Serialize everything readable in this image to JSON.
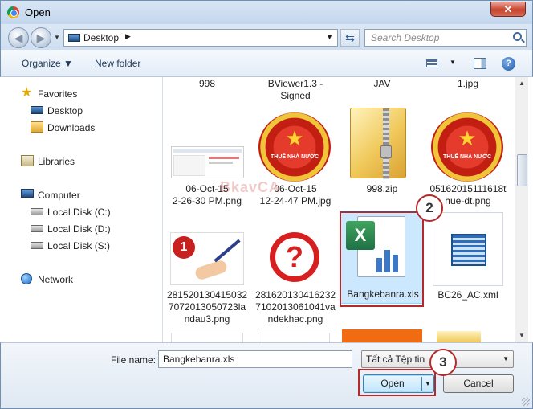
{
  "window": {
    "title": "Open",
    "close_symbol": "✕"
  },
  "nav": {
    "back_symbol": "◀",
    "forward_symbol": "▶",
    "dropdown_symbol": "▼",
    "breadcrumb": "Desktop",
    "crumb_sep": "▶",
    "refresh_symbol": "⇆",
    "search_placeholder": "Search Desktop"
  },
  "toolbar": {
    "organize": "Organize ▼",
    "new_folder": "New folder",
    "view_dd": "▼",
    "help": "?"
  },
  "sidebar": {
    "favorites": "Favorites",
    "desktop": "Desktop",
    "downloads": "Downloads",
    "libraries": "Libraries",
    "computer": "Computer",
    "disk_c": "Local Disk (C:)",
    "disk_d": "Local Disk (D:)",
    "disk_s": "Local Disk (S:)",
    "network": "Network"
  },
  "files": {
    "row0": [
      "998",
      "BViewer1.3 - Signed",
      "JAV",
      "1.jpg"
    ],
    "f1": "06-Oct-15 2-26-30 PM.png",
    "f2": "06-Oct-15 12-24-47 PM.jpg",
    "f3": "998.zip",
    "f4": "05162015111618thue-dt.png",
    "f5": "281520130415032707201305072 3landau3.png",
    "f5_l1": "281520130415032",
    "f5_l2": "7072013050723la",
    "f5_l3": "ndau3.png",
    "f6_l1": "281620130416232",
    "f6_l2": "7102013061041va",
    "f6_l3": "ndekhac.png",
    "f7": "Bangkebanra.xls",
    "f8": "BC26_AC.xml",
    "f1_l1": "06-Oct-15",
    "f1_l2": "2-26-30 PM.png",
    "f2_l1": "06-Oct-15",
    "f2_l2": "12-24-47 PM.jpg",
    "f4_l1": "05162015111618t",
    "f4_l2": "hue-dt.png",
    "row0_1_l1": "BViewer1.3 -",
    "row0_1_l2": "Signed",
    "seal_text": "THUẾ NHÀ NƯỚC",
    "seal_star": "★",
    "question_mark": "?",
    "number_one": "1"
  },
  "watermark": "BkavCA",
  "bottom": {
    "file_name_label": "File name:",
    "file_name_value": "Bangkebanra.xls",
    "file_type": "Tất cả Tệp tin",
    "open": "Open",
    "cancel": "Cancel",
    "dd": "▼"
  },
  "badges": {
    "b2": "2",
    "b3": "3"
  },
  "scroll": {
    "up": "▲",
    "down": "▼"
  },
  "colors": {
    "highlight": "#b22a2a",
    "accent": "#3c7fb1",
    "excel_green": "#1e7145"
  }
}
